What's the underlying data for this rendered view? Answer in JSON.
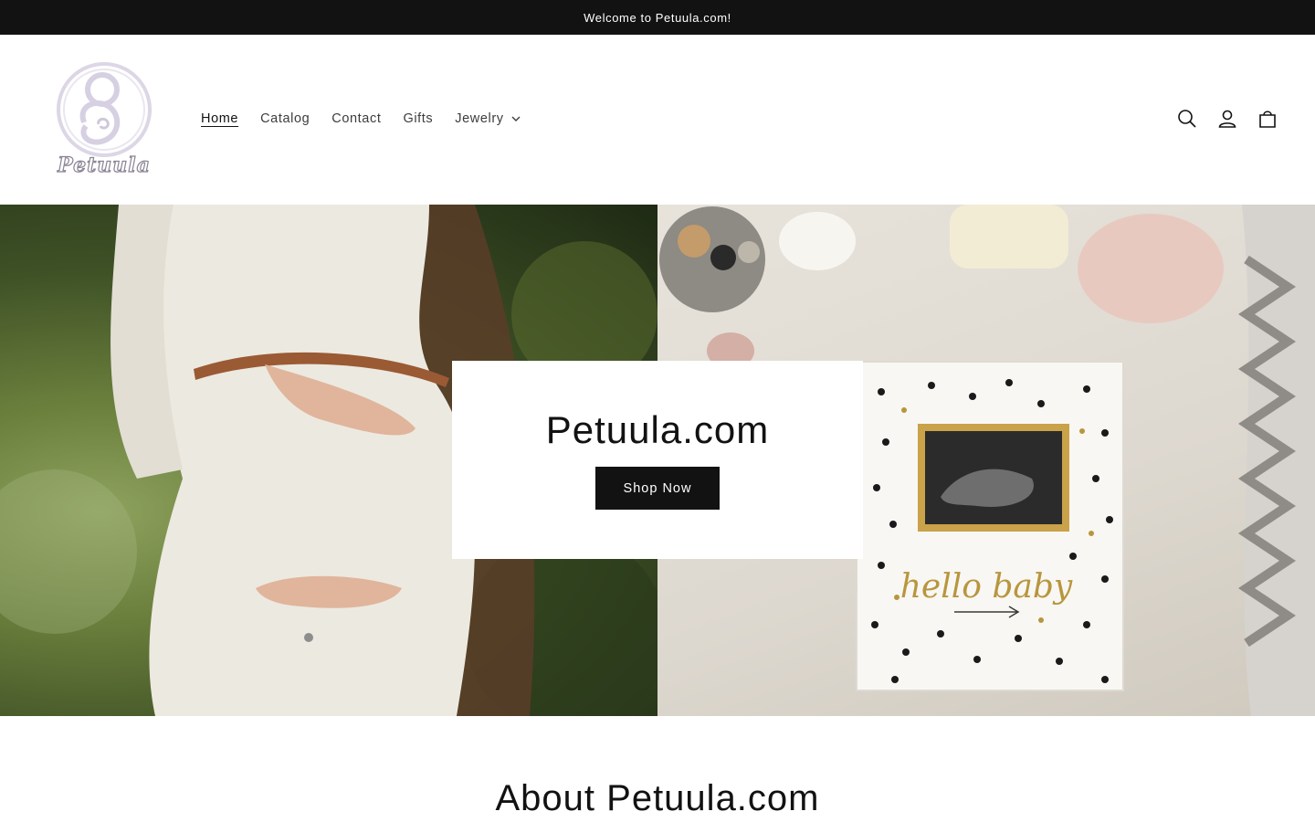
{
  "announcement": {
    "text": "Welcome to Petuula.com!"
  },
  "header": {
    "logo_text": "Petuula",
    "nav": [
      {
        "label": "Home",
        "active": true
      },
      {
        "label": "Catalog"
      },
      {
        "label": "Contact"
      },
      {
        "label": "Gifts"
      },
      {
        "label": "Jewelry",
        "has_dropdown": true
      }
    ],
    "icons": [
      "search-icon",
      "account-icon",
      "cart-icon"
    ]
  },
  "hero": {
    "title": "Petuula.com",
    "button_label": "Shop Now",
    "book_text": "hello baby"
  },
  "about": {
    "title": "About Petuula.com"
  },
  "colors": {
    "dark": "#121212",
    "white": "#ffffff",
    "nav_text": "#3d3d3d",
    "gold": "#b8963e"
  }
}
